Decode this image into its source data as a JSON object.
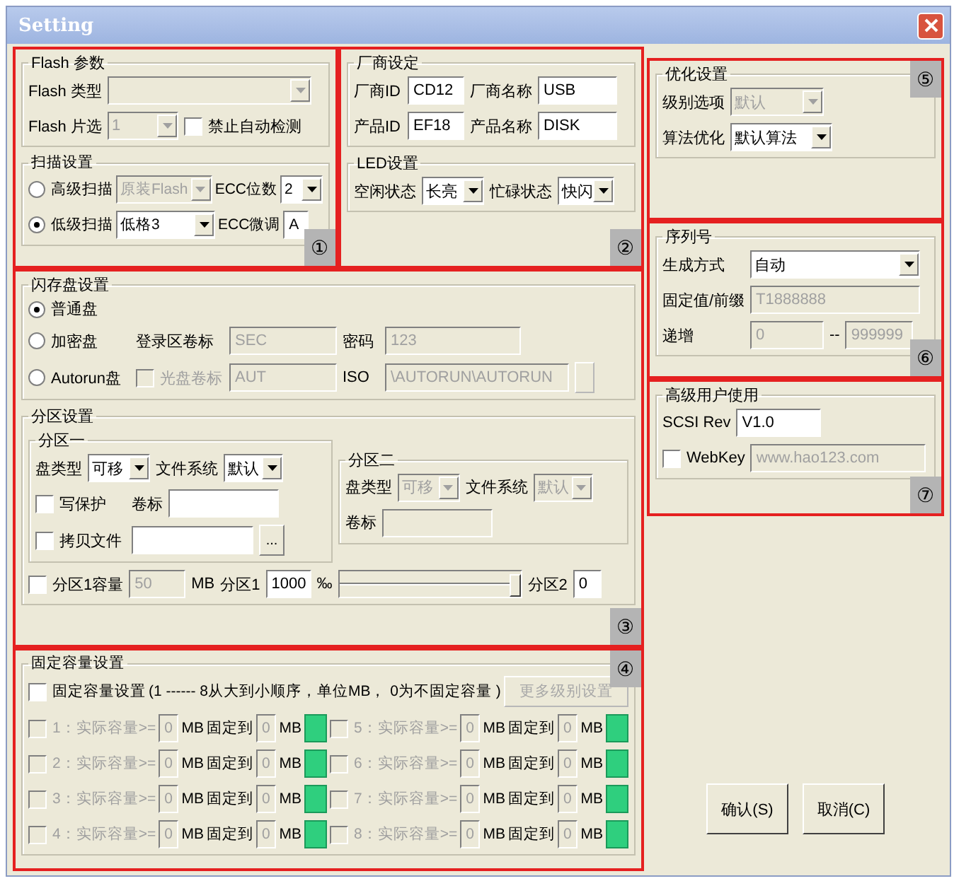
{
  "window": {
    "title": "Setting"
  },
  "sections": [
    {
      "callout": "①",
      "groups": [
        {
          "title": "Flash 参数",
          "rows": [
            [
              {
                "kind": "label",
                "text": "Flash 类型"
              },
              {
                "kind": "combo",
                "disabled": true
              }
            ],
            [
              {
                "kind": "label",
                "text": "Flash 片选"
              },
              {
                "kind": "combo",
                "value": "1",
                "disabled": true
              },
              {
                "kind": "check",
                "label": "禁止自动检测",
                "checked": false
              }
            ]
          ]
        },
        {
          "title": "扫描设置",
          "rows": [
            [
              {
                "kind": "radio",
                "label": "高级扫描",
                "selected": false
              },
              {
                "kind": "combo",
                "value": "原装Flash",
                "disabled": true
              },
              {
                "kind": "label",
                "text": "ECC位数"
              },
              {
                "kind": "combo",
                "value": "2"
              }
            ],
            [
              {
                "kind": "radio",
                "label": "低级扫描",
                "selected": true
              },
              {
                "kind": "combo",
                "value": "低格3"
              },
              {
                "kind": "label",
                "text": "ECC微调"
              },
              {
                "kind": "input",
                "value": "A"
              }
            ]
          ]
        }
      ]
    },
    {
      "callout": "②",
      "groups": [
        {
          "title": "厂商设定",
          "rows": [
            [
              {
                "kind": "label",
                "text": "厂商ID"
              },
              {
                "kind": "input",
                "value": "CD12"
              },
              {
                "kind": "label",
                "text": "厂商名称"
              },
              {
                "kind": "input",
                "value": "USB"
              }
            ],
            [
              {
                "kind": "label",
                "text": "产品ID"
              },
              {
                "kind": "input",
                "value": "EF18"
              },
              {
                "kind": "label",
                "text": "产品名称"
              },
              {
                "kind": "input",
                "value": "DISK"
              }
            ]
          ]
        },
        {
          "title": "LED设置",
          "rows": [
            [
              {
                "kind": "label",
                "text": "空闲状态"
              },
              {
                "kind": "combo",
                "value": "长亮"
              },
              {
                "kind": "label",
                "text": "忙碌状态"
              },
              {
                "kind": "combo",
                "value": "快闪"
              }
            ]
          ]
        }
      ]
    },
    {
      "callout": "③",
      "groups": [
        {
          "title": "闪存盘设置",
          "rows": [
            [
              {
                "kind": "radio",
                "label": "普通盘",
                "selected": true
              }
            ],
            [
              {
                "kind": "radio",
                "label": "加密盘",
                "selected": false
              },
              {
                "kind": "label",
                "text": "登录区卷标"
              },
              {
                "kind": "input",
                "value": "SEC",
                "disabled": true
              },
              {
                "kind": "label",
                "text": "密码"
              },
              {
                "kind": "input",
                "value": "123",
                "disabled": true
              }
            ],
            [
              {
                "kind": "radio",
                "label": "Autorun盘",
                "selected": false
              },
              {
                "kind": "check",
                "label": "光盘卷标",
                "checked": false,
                "disabled": true
              },
              {
                "kind": "input",
                "value": "AUT",
                "disabled": true
              },
              {
                "kind": "label",
                "text": "ISO"
              },
              {
                "kind": "input",
                "value": "\\AUTORUN\\AUTORUN",
                "disabled": true
              },
              {
                "kind": "browse",
                "disabled": true
              }
            ]
          ]
        },
        {
          "title": "分区设置",
          "groups": [
            {
              "title": "分区一",
              "rows": [
                [
                  {
                    "kind": "label",
                    "text": "盘类型"
                  },
                  {
                    "kind": "combo",
                    "value": "可移"
                  },
                  {
                    "kind": "label",
                    "text": "文件系统"
                  },
                  {
                    "kind": "combo",
                    "value": "默认"
                  }
                ],
                [
                  {
                    "kind": "check",
                    "label": "写保护",
                    "checked": false
                  },
                  {
                    "kind": "label",
                    "text": "卷标"
                  },
                  {
                    "kind": "input"
                  }
                ],
                [
                  {
                    "kind": "check",
                    "label": "拷贝文件",
                    "checked": false
                  },
                  {
                    "kind": "input"
                  },
                  {
                    "kind": "browse",
                    "text": "..."
                  }
                ]
              ]
            },
            {
              "title": "分区二",
              "rows": [
                [
                  {
                    "kind": "label",
                    "text": "盘类型"
                  },
                  {
                    "kind": "combo",
                    "value": "可移",
                    "disabled": true
                  },
                  {
                    "kind": "label",
                    "text": "文件系统"
                  },
                  {
                    "kind": "combo",
                    "value": "默认",
                    "disabled": true
                  }
                ],
                [
                  {
                    "kind": "label",
                    "text": "卷标"
                  },
                  {
                    "kind": "input",
                    "disabled": true
                  }
                ]
              ]
            }
          ],
          "rows": [
            [
              {
                "kind": "check",
                "label": "分区1容量",
                "checked": false
              },
              {
                "kind": "input",
                "value": "50",
                "disabled": true
              },
              {
                "kind": "label",
                "text": "MB"
              },
              {
                "kind": "label",
                "text": "分区1"
              },
              {
                "kind": "input",
                "value": "1000"
              },
              {
                "kind": "label",
                "text": "‰"
              },
              {
                "kind": "slider",
                "level": 1
              },
              {
                "kind": "label",
                "text": "分区2"
              },
              {
                "kind": "input",
                "value": "0"
              }
            ]
          ]
        }
      ]
    },
    {
      "callout": "④",
      "groups": [
        {
          "title": "固定容量设置",
          "header": [
            {
              "kind": "check",
              "label": "固定容量设置",
              "checked": false
            },
            {
              "kind": "label",
              "text": "(1 ------ 8从大到小顺序，单位MB， 0为不固定容量 )"
            },
            {
              "kind": "button",
              "text": "更多级别设置",
              "disabled": true
            }
          ],
          "rows": [
            [
              {
                "kind": "check",
                "label": "1：实际容量>=",
                "checked": false,
                "disabled": true
              },
              {
                "kind": "input",
                "value": "0",
                "disabled": true
              },
              {
                "kind": "label",
                "text": "MB"
              },
              {
                "kind": "label",
                "text": "固定到"
              },
              {
                "kind": "input",
                "value": "0",
                "disabled": true
              },
              {
                "kind": "label",
                "text": "MB"
              },
              {
                "kind": "swatch"
              },
              {
                "kind": "check",
                "label": "5：实际容量>=",
                "checked": false,
                "disabled": true
              },
              {
                "kind": "input",
                "value": "0",
                "disabled": true
              },
              {
                "kind": "label",
                "text": "MB"
              },
              {
                "kind": "label",
                "text": "固定到"
              },
              {
                "kind": "input",
                "value": "0",
                "disabled": true
              },
              {
                "kind": "label",
                "text": "MB"
              },
              {
                "kind": "swatch"
              }
            ],
            [
              {
                "kind": "check",
                "label": "2：实际容量>=",
                "checked": false,
                "disabled": true
              },
              {
                "kind": "input",
                "value": "0",
                "disabled": true
              },
              {
                "kind": "label",
                "text": "MB"
              },
              {
                "kind": "label",
                "text": "固定到"
              },
              {
                "kind": "input",
                "value": "0",
                "disabled": true
              },
              {
                "kind": "label",
                "text": "MB"
              },
              {
                "kind": "swatch"
              },
              {
                "kind": "check",
                "label": "6：实际容量>=",
                "checked": false,
                "disabled": true
              },
              {
                "kind": "input",
                "value": "0",
                "disabled": true
              },
              {
                "kind": "label",
                "text": "MB"
              },
              {
                "kind": "label",
                "text": "固定到"
              },
              {
                "kind": "input",
                "value": "0",
                "disabled": true
              },
              {
                "kind": "label",
                "text": "MB"
              },
              {
                "kind": "swatch"
              }
            ],
            [
              {
                "kind": "check",
                "label": "3：实际容量>=",
                "checked": false,
                "disabled": true
              },
              {
                "kind": "input",
                "value": "0",
                "disabled": true
              },
              {
                "kind": "label",
                "text": "MB"
              },
              {
                "kind": "label",
                "text": "固定到"
              },
              {
                "kind": "input",
                "value": "0",
                "disabled": true
              },
              {
                "kind": "label",
                "text": "MB"
              },
              {
                "kind": "swatch"
              },
              {
                "kind": "check",
                "label": "7：实际容量>=",
                "checked": false,
                "disabled": true
              },
              {
                "kind": "input",
                "value": "0",
                "disabled": true
              },
              {
                "kind": "label",
                "text": "MB"
              },
              {
                "kind": "label",
                "text": "固定到"
              },
              {
                "kind": "input",
                "value": "0",
                "disabled": true
              },
              {
                "kind": "label",
                "text": "MB"
              },
              {
                "kind": "swatch"
              }
            ],
            [
              {
                "kind": "check",
                "label": "4：实际容量>=",
                "checked": false,
                "disabled": true
              },
              {
                "kind": "input",
                "value": "0",
                "disabled": true
              },
              {
                "kind": "label",
                "text": "MB"
              },
              {
                "kind": "label",
                "text": "固定到"
              },
              {
                "kind": "input",
                "value": "0",
                "disabled": true
              },
              {
                "kind": "label",
                "text": "MB"
              },
              {
                "kind": "swatch"
              },
              {
                "kind": "check",
                "label": "8：实际容量>=",
                "checked": false,
                "disabled": true
              },
              {
                "kind": "input",
                "value": "0",
                "disabled": true
              },
              {
                "kind": "label",
                "text": "MB"
              },
              {
                "kind": "label",
                "text": "固定到"
              },
              {
                "kind": "input",
                "value": "0",
                "disabled": true
              },
              {
                "kind": "label",
                "text": "MB"
              },
              {
                "kind": "swatch"
              }
            ]
          ]
        }
      ]
    },
    {
      "callout": "⑤",
      "groups": [
        {
          "title": "优化设置",
          "rows": [
            [
              {
                "kind": "label",
                "text": "级别选项"
              },
              {
                "kind": "combo",
                "value": "默认",
                "disabled": true
              }
            ],
            [
              {
                "kind": "label",
                "text": "算法优化"
              },
              {
                "kind": "combo",
                "value": "默认算法"
              }
            ]
          ]
        }
      ]
    },
    {
      "callout": "⑥",
      "groups": [
        {
          "title": "序列号",
          "rows": [
            [
              {
                "kind": "label",
                "text": "生成方式"
              },
              {
                "kind": "combo",
                "value": "自动"
              }
            ],
            [
              {
                "kind": "label",
                "text": "固定值/前缀"
              },
              {
                "kind": "input",
                "value": "T1888888",
                "disabled": true
              }
            ],
            [
              {
                "kind": "label",
                "text": "递增"
              },
              {
                "kind": "input",
                "value": "0",
                "disabled": true
              },
              {
                "kind": "label",
                "text": "--"
              },
              {
                "kind": "input",
                "value": "999999",
                "disabled": true
              }
            ]
          ]
        }
      ]
    },
    {
      "callout": "⑦",
      "groups": [
        {
          "title": "高级用户使用",
          "rows": [
            [
              {
                "kind": "label",
                "text": "SCSI Rev"
              },
              {
                "kind": "input",
                "value": "V1.0"
              }
            ],
            [
              {
                "kind": "check",
                "label": "WebKey",
                "checked": false
              },
              {
                "kind": "input",
                "value": "www.hao123.com",
                "disabled": true
              }
            ]
          ]
        }
      ]
    }
  ],
  "buttons": [
    "确认(S)",
    "取消(C)"
  ]
}
